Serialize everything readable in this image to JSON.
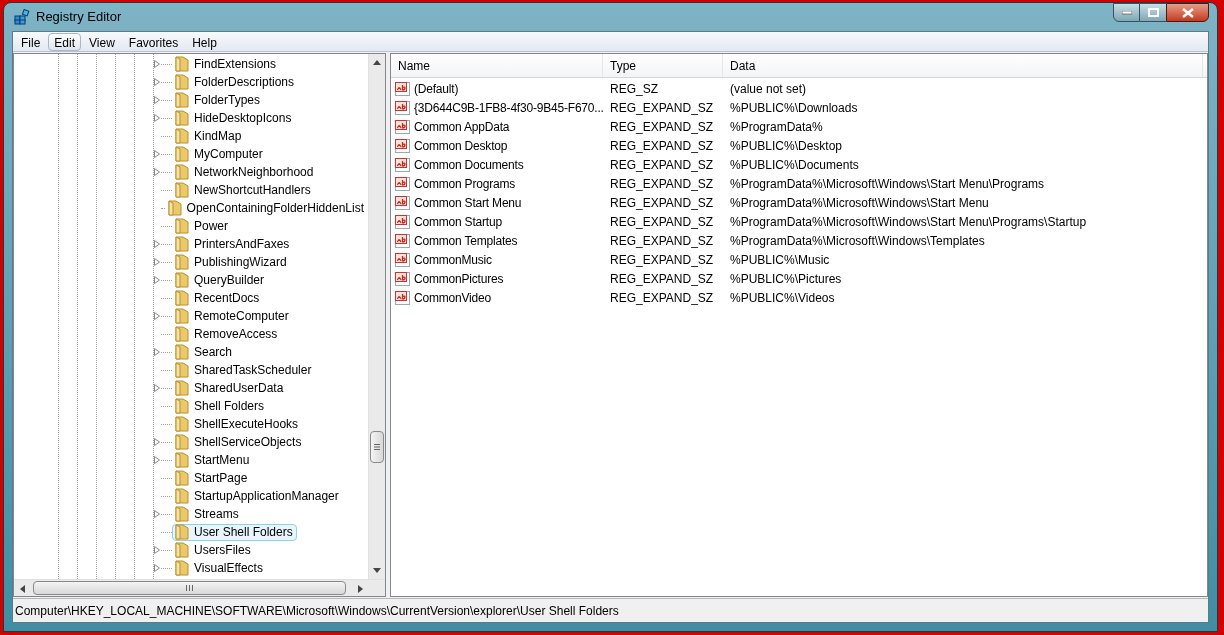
{
  "window": {
    "title": "Registry Editor"
  },
  "menu": [
    {
      "label": "File",
      "selected": false
    },
    {
      "label": "Edit",
      "selected": true
    },
    {
      "label": "View",
      "selected": false
    },
    {
      "label": "Favorites",
      "selected": false
    },
    {
      "label": "Help",
      "selected": false
    }
  ],
  "tree": {
    "items": [
      {
        "label": "FindExtensions",
        "expandable": true,
        "selected": false
      },
      {
        "label": "FolderDescriptions",
        "expandable": true,
        "selected": false
      },
      {
        "label": "FolderTypes",
        "expandable": true,
        "selected": false
      },
      {
        "label": "HideDesktopIcons",
        "expandable": true,
        "selected": false
      },
      {
        "label": "KindMap",
        "expandable": false,
        "selected": false
      },
      {
        "label": "MyComputer",
        "expandable": true,
        "selected": false
      },
      {
        "label": "NetworkNeighborhood",
        "expandable": true,
        "selected": false
      },
      {
        "label": "NewShortcutHandlers",
        "expandable": false,
        "selected": false
      },
      {
        "label": "OpenContainingFolderHiddenList",
        "expandable": false,
        "selected": false
      },
      {
        "label": "Power",
        "expandable": false,
        "selected": false
      },
      {
        "label": "PrintersAndFaxes",
        "expandable": true,
        "selected": false
      },
      {
        "label": "PublishingWizard",
        "expandable": true,
        "selected": false
      },
      {
        "label": "QueryBuilder",
        "expandable": true,
        "selected": false
      },
      {
        "label": "RecentDocs",
        "expandable": false,
        "selected": false
      },
      {
        "label": "RemoteComputer",
        "expandable": true,
        "selected": false
      },
      {
        "label": "RemoveAccess",
        "expandable": false,
        "selected": false
      },
      {
        "label": "Search",
        "expandable": true,
        "selected": false
      },
      {
        "label": "SharedTaskScheduler",
        "expandable": false,
        "selected": false
      },
      {
        "label": "SharedUserData",
        "expandable": true,
        "selected": false
      },
      {
        "label": "Shell Folders",
        "expandable": false,
        "selected": false
      },
      {
        "label": "ShellExecuteHooks",
        "expandable": false,
        "selected": false
      },
      {
        "label": "ShellServiceObjects",
        "expandable": true,
        "selected": false
      },
      {
        "label": "StartMenu",
        "expandable": true,
        "selected": false
      },
      {
        "label": "StartPage",
        "expandable": false,
        "selected": false
      },
      {
        "label": "StartupApplicationManager",
        "expandable": false,
        "selected": false
      },
      {
        "label": "Streams",
        "expandable": true,
        "selected": false
      },
      {
        "label": "User Shell Folders",
        "expandable": false,
        "selected": true
      },
      {
        "label": "UsersFiles",
        "expandable": true,
        "selected": false
      },
      {
        "label": "VisualEffects",
        "expandable": true,
        "selected": false
      }
    ]
  },
  "table": {
    "columns": [
      "Name",
      "Type",
      "Data"
    ],
    "rows": [
      [
        "(Default)",
        "REG_SZ",
        "(value not set)"
      ],
      [
        "{3D644C9B-1FB8-4f30-9B45-F670...",
        "REG_EXPAND_SZ",
        "%PUBLIC%\\Downloads"
      ],
      [
        "Common AppData",
        "REG_EXPAND_SZ",
        "%ProgramData%"
      ],
      [
        "Common Desktop",
        "REG_EXPAND_SZ",
        "%PUBLIC%\\Desktop"
      ],
      [
        "Common Documents",
        "REG_EXPAND_SZ",
        "%PUBLIC%\\Documents"
      ],
      [
        "Common Programs",
        "REG_EXPAND_SZ",
        "%ProgramData%\\Microsoft\\Windows\\Start Menu\\Programs"
      ],
      [
        "Common Start Menu",
        "REG_EXPAND_SZ",
        "%ProgramData%\\Microsoft\\Windows\\Start Menu"
      ],
      [
        "Common Startup",
        "REG_EXPAND_SZ",
        "%ProgramData%\\Microsoft\\Windows\\Start Menu\\Programs\\Startup"
      ],
      [
        "Common Templates",
        "REG_EXPAND_SZ",
        "%ProgramData%\\Microsoft\\Windows\\Templates"
      ],
      [
        "CommonMusic",
        "REG_EXPAND_SZ",
        "%PUBLIC%\\Music"
      ],
      [
        "CommonPictures",
        "REG_EXPAND_SZ",
        "%PUBLIC%\\Pictures"
      ],
      [
        "CommonVideo",
        "REG_EXPAND_SZ",
        "%PUBLIC%\\Videos"
      ]
    ]
  },
  "status_bar": "Computer\\HKEY_LOCAL_MACHINE\\SOFTWARE\\Microsoft\\Windows\\CurrentVersion\\explorer\\User Shell Folders"
}
